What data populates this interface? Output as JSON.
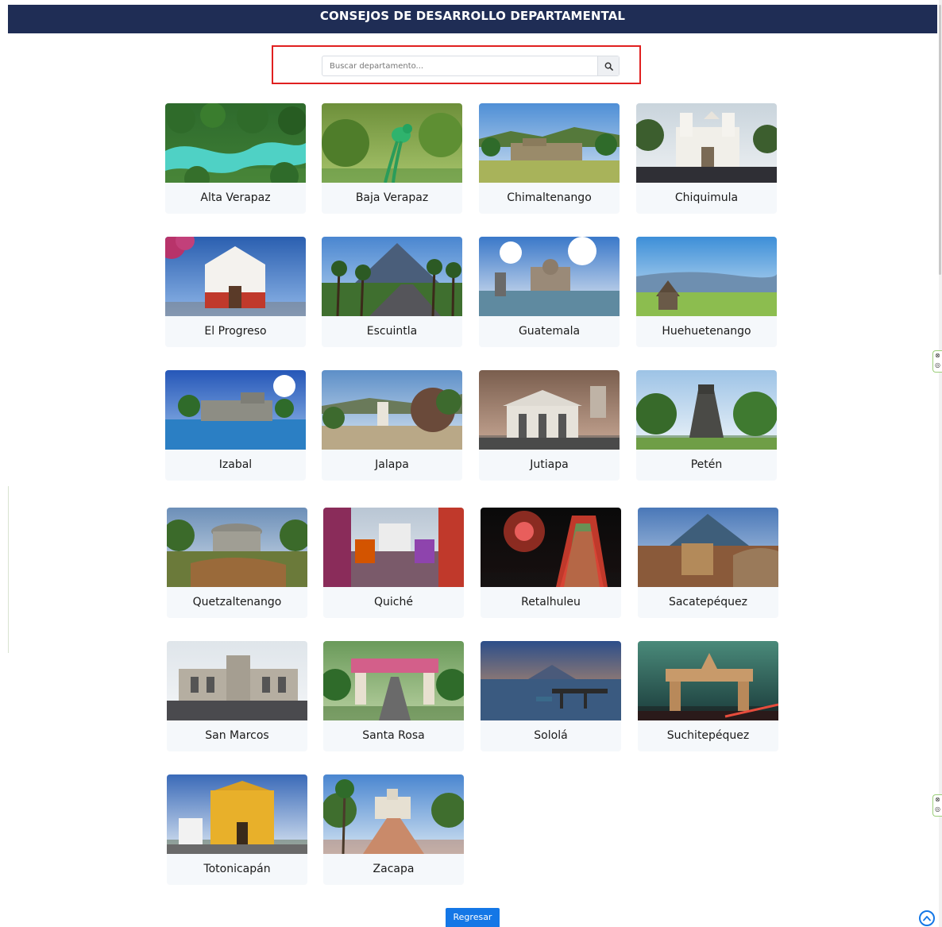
{
  "header": {
    "title": "CONSEJOS DE DESARROLLO DEPARTAMENTAL"
  },
  "search": {
    "placeholder": "Buscar departamento..."
  },
  "icons": {
    "search": "search-icon",
    "back_to_top": "chevron-up-icon"
  },
  "colors": {
    "header_bg": "#1f2d55",
    "accent": "#1477e6",
    "highlight": "#e02020",
    "card_bg": "#f5f8fb"
  },
  "departments": [
    {
      "name": "Alta Verapaz",
      "scene": "river"
    },
    {
      "name": "Baja Verapaz",
      "scene": "bird"
    },
    {
      "name": "Chimaltenango",
      "scene": "ruins"
    },
    {
      "name": "Chiquimula",
      "scene": "church-white"
    },
    {
      "name": "El Progreso",
      "scene": "church-red"
    },
    {
      "name": "Escuintla",
      "scene": "volcano-road"
    },
    {
      "name": "Guatemala",
      "scene": "palace"
    },
    {
      "name": "Huehuetenango",
      "scene": "valley"
    },
    {
      "name": "Izabal",
      "scene": "fort"
    },
    {
      "name": "Jalapa",
      "scene": "town"
    },
    {
      "name": "Jutiapa",
      "scene": "kiosk"
    },
    {
      "name": "Petén",
      "scene": "pyramid"
    },
    {
      "name": "Quetzaltenango",
      "scene": "rotunda"
    },
    {
      "name": "Quiché",
      "scene": "market"
    },
    {
      "name": "Retalhuleu",
      "scene": "fireworks"
    },
    {
      "name": "Sacatepéquez",
      "scene": "volcano-city"
    },
    {
      "name": "San Marcos",
      "scene": "palace-grey"
    },
    {
      "name": "Santa Rosa",
      "scene": "arch-road"
    },
    {
      "name": "Sololá",
      "scene": "lake"
    },
    {
      "name": "Suchitepéquez",
      "scene": "arch-night"
    },
    {
      "name": "Totonicapán",
      "scene": "church-yellow"
    },
    {
      "name": "Zacapa",
      "scene": "plaza"
    }
  ],
  "footer": {
    "back_label": "Regresar"
  }
}
